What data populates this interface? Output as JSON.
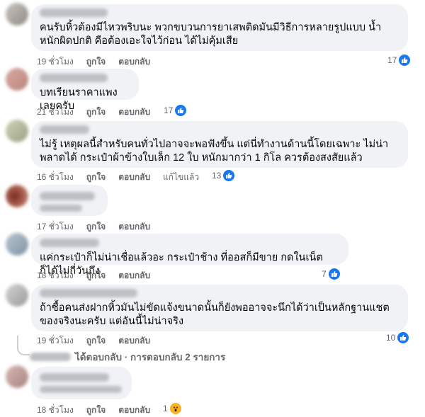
{
  "comments": [
    {
      "text": "คนรับหิ้วต้องมีไหวพริบนะ พวกขบวนการยาเสพติดมันมีวิธีการหลายรูปแบบ น้ำหนักผิดปกติ คือต้องเอะใจไว้ก่อน ได้ไม่คุ้มเสีย",
      "time": "19 ชั่วโมง",
      "like": "ถูกใจ",
      "reply": "ตอบกลับ",
      "edited": "",
      "reaction_count": "17",
      "reaction_icon": "like-icon"
    },
    {
      "text": "บทเรียนราคาแพงเลยครับ",
      "time": "21 ชั่วโมง",
      "like": "ถูกใจ",
      "reply": "ตอบกลับ",
      "edited": "",
      "reaction_count": "17",
      "reaction_icon": "like-icon"
    },
    {
      "text": "ไม่รู้ เหตุผลนี้สำหรับคนทั่วไปอาจจะพอฟังขึ้น แต่นี่ทำงานด้านนี้โดยเฉพาะ ไม่น่าพลาดได้ กระเป๋าผ้าข้างใบเล็ก 12 ใบ หนักมากว่า 1 กิโล ควรต้องสงสัยแล้ว",
      "time": "16 ชั่วโมง",
      "like": "ถูกใจ",
      "reply": "ตอบกลับ",
      "edited": "แก้ไขแล้ว",
      "reaction_count": "13",
      "reaction_icon": "like-icon"
    },
    {
      "text": "",
      "time": "17 ชั่วโมง",
      "like": "ถูกใจ",
      "reply": "ตอบกลับ",
      "edited": "",
      "reaction_count": "",
      "reaction_icon": ""
    },
    {
      "text": "แค่กระเป๋าก็ไม่น่าเชื่อแล้วอะ กระเป๋าช้าง ที่ออสก็มีขาย กดในเน็ตก็ได้ไม่กี่วันถึง",
      "time": "18 ชั่วโมง",
      "like": "ถูกใจ",
      "reply": "ตอบกลับ",
      "edited": "",
      "reaction_count": "7",
      "reaction_icon": "like-icon"
    },
    {
      "text": "ถ้าซื้อคนส่งฝากหิ้วมันไม่ขัดแจ้งขนาดนั้นก็ยังพออาจจะนึกได้ว่าเป็นหลักฐานแชตของจริงนะครับ แต่อันนี้ไม่น่าจริง",
      "time": "19 ชั่วโมง",
      "like": "ถูกใจ",
      "reply": "ตอบกลับ",
      "edited": "",
      "reaction_count": "10",
      "reaction_icon": "like-icon"
    },
    {
      "text": "",
      "time": "18 ชั่วโมง",
      "like": "ถูกใจ",
      "reply": "ตอบกลับ",
      "edited": "",
      "reaction_count": "1",
      "reaction_icon": "wow-icon"
    }
  ],
  "replies_summary": "ได้ตอบกลับ · การตอบกลับ 2 รายการ",
  "colors": {
    "bubble": "#f0f2f5",
    "meta_text": "#65676b",
    "like_blue": "#1877f2",
    "wow_yellow": "#f7b125"
  }
}
